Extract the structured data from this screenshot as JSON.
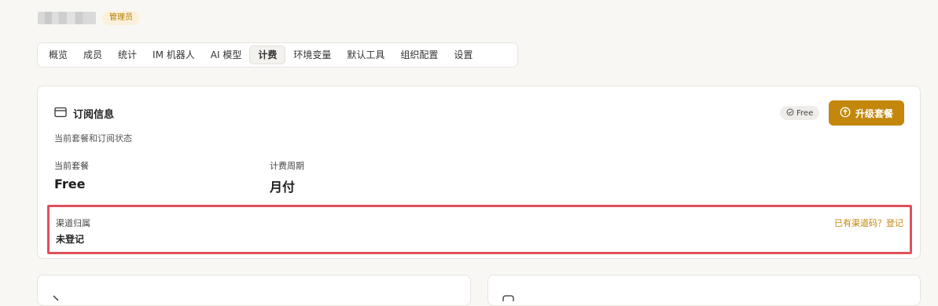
{
  "header": {
    "role_badge": "管理员"
  },
  "tabs": [
    {
      "label": "概览"
    },
    {
      "label": "成员"
    },
    {
      "label": "统计"
    },
    {
      "label": "IM 机器人"
    },
    {
      "label": "AI 模型"
    },
    {
      "label": "计费",
      "active": true
    },
    {
      "label": "环境变量"
    },
    {
      "label": "默认工具"
    },
    {
      "label": "组织配置"
    },
    {
      "label": "设置"
    }
  ],
  "subscription": {
    "icon": "credit-card-icon",
    "title": "订阅信息",
    "description": "当前套餐和订阅状态",
    "plan_badge": "Free",
    "upgrade_label": "升级套餐",
    "current_plan_label": "当前套餐",
    "current_plan_value": "Free",
    "billing_cycle_label": "计费周期",
    "billing_cycle_value": "月付",
    "channel": {
      "label": "渠道归属",
      "value": "未登记",
      "link": "已有渠道码？登记"
    }
  },
  "colors": {
    "accent": "#c3870c",
    "highlight_border": "#e0505c",
    "background": "#f8f7f4"
  }
}
